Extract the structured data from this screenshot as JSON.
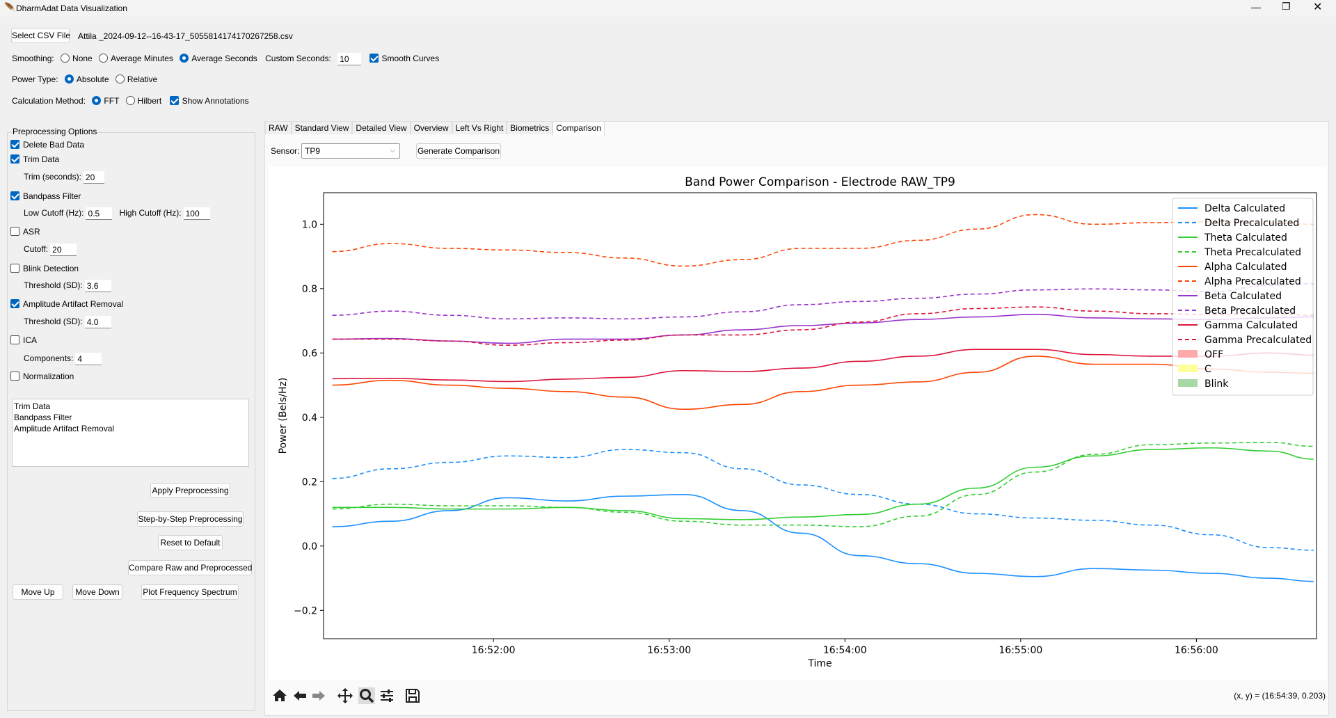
{
  "window": {
    "title": "DharmAdat Data Visualization",
    "icon": "feather-icon"
  },
  "file": {
    "button": "Select CSV File",
    "name": "Attila _2024-09-12--16-43-17_5055814174170267258.csv"
  },
  "smoothing": {
    "label": "Smoothing:",
    "options": [
      "None",
      "Average Minutes",
      "Average Seconds"
    ],
    "selected": "Average Seconds",
    "custom_label": "Custom Seconds:",
    "custom_value": "10",
    "smooth_curves": "Smooth Curves",
    "smooth_checked": true
  },
  "power": {
    "label": "Power Type:",
    "options": [
      "Absolute",
      "Relative"
    ],
    "selected": "Absolute"
  },
  "calc": {
    "label": "Calculation Method:",
    "options": [
      "FFT",
      "Hilbert"
    ],
    "selected": "FFT",
    "annotations": "Show Annotations",
    "annotations_checked": true
  },
  "prep": {
    "title": "Preprocessing Options",
    "delete_bad": "Delete Bad Data",
    "trim": "Trim Data",
    "trim_label": "Trim (seconds):",
    "trim_value": "20",
    "bandpass": "Bandpass Filter",
    "low_label": "Low Cutoff (Hz):",
    "low_value": "0.5",
    "high_label": "High Cutoff (Hz):",
    "high_value": "100",
    "asr": "ASR",
    "asr_label": "Cutoff:",
    "asr_value": "20",
    "blink": "Blink Detection",
    "blink_label": "Threshold (SD):",
    "blink_value": "3.6",
    "amp": "Amplitude Artifact Removal",
    "amp_label": "Threshold (SD):",
    "amp_value": "4.0",
    "ica": "ICA",
    "ica_label": "Components:",
    "ica_value": "4",
    "norm": "Normalization",
    "checked": {
      "delete_bad": true,
      "trim": true,
      "bandpass": true,
      "asr": false,
      "blink": false,
      "amp": true,
      "ica": false,
      "norm": false
    },
    "steps": [
      "Trim Data",
      "Bandpass Filter",
      "Amplitude Artifact Removal"
    ],
    "buttons": {
      "apply": "Apply Preprocessing",
      "step": "Step-by-Step Preprocessing",
      "reset": "Reset to Default",
      "compare": "Compare Raw and Preprocessed",
      "up": "Move Up",
      "down": "Move Down",
      "freq": "Plot Frequency Spectrum"
    }
  },
  "tabs": [
    "RAW",
    "Standard View",
    "Detailed View",
    "Overview",
    "Left Vs Right",
    "Biometrics",
    "Comparison"
  ],
  "active_tab": "Comparison",
  "sensor": {
    "label": "Sensor:",
    "value": "TP9",
    "generate": "Generate Comparison"
  },
  "status": {
    "coords": "(x, y) = (16:54:39, 0.203)"
  },
  "toolbar": [
    "home-icon",
    "back-icon",
    "forward-icon",
    "pan-icon",
    "zoom-icon",
    "configure-icon",
    "save-icon"
  ],
  "chart_data": {
    "type": "line",
    "title": "Band Power Comparison - Electrode RAW_TP9",
    "xlabel": "Time",
    "ylabel": "Power (Bels/Hz)",
    "xlim": [
      "16:51:02",
      "16:56:41"
    ],
    "ylim": [
      -0.288,
      1.098
    ],
    "xticks": [
      "16:52:00",
      "16:53:00",
      "16:54:00",
      "16:55:00",
      "16:56:00"
    ],
    "yticks": [
      -0.2,
      0.0,
      0.2,
      0.4,
      0.6,
      0.8,
      1.0
    ],
    "grid": false,
    "legend": "top-right",
    "x": [
      "16:51:05",
      "16:51:25",
      "16:51:45",
      "16:52:05",
      "16:52:25",
      "16:52:45",
      "16:53:05",
      "16:53:25",
      "16:53:45",
      "16:54:05",
      "16:54:25",
      "16:54:45",
      "16:55:05",
      "16:55:25",
      "16:55:45",
      "16:56:05",
      "16:56:25",
      "16:56:40"
    ],
    "series": [
      {
        "name": "Delta Calculated",
        "color": "#1e90ff",
        "dash": false,
        "values": [
          0.06,
          0.077,
          0.11,
          0.15,
          0.14,
          0.155,
          0.16,
          0.11,
          0.04,
          -0.03,
          -0.055,
          -0.085,
          -0.095,
          -0.07,
          -0.075,
          -0.085,
          -0.1,
          -0.11
        ]
      },
      {
        "name": "Delta Precalculated",
        "color": "#1e90ff",
        "dash": true,
        "values": [
          0.21,
          0.24,
          0.26,
          0.28,
          0.275,
          0.3,
          0.29,
          0.24,
          0.19,
          0.16,
          0.13,
          0.1,
          0.087,
          0.08,
          0.065,
          0.035,
          -0.005,
          -0.013
        ]
      },
      {
        "name": "Theta Calculated",
        "color": "#32cd32",
        "dash": false,
        "values": [
          0.12,
          0.12,
          0.115,
          0.115,
          0.12,
          0.11,
          0.085,
          0.082,
          0.09,
          0.098,
          0.13,
          0.18,
          0.245,
          0.28,
          0.3,
          0.305,
          0.295,
          0.27
        ]
      },
      {
        "name": "Theta Precalculated",
        "color": "#32cd32",
        "dash": true,
        "values": [
          0.115,
          0.13,
          0.125,
          0.125,
          0.12,
          0.105,
          0.077,
          0.065,
          0.065,
          0.06,
          0.093,
          0.16,
          0.23,
          0.285,
          0.315,
          0.32,
          0.322,
          0.31
        ]
      },
      {
        "name": "Alpha Calculated",
        "color": "#ff4500",
        "dash": false,
        "values": [
          0.5,
          0.515,
          0.5,
          0.49,
          0.48,
          0.463,
          0.425,
          0.44,
          0.48,
          0.5,
          0.51,
          0.54,
          0.59,
          0.565,
          0.565,
          0.55,
          0.54,
          0.537
        ]
      },
      {
        "name": "Alpha Precalculated",
        "color": "#ff4500",
        "dash": true,
        "values": [
          0.915,
          0.94,
          0.925,
          0.92,
          0.912,
          0.895,
          0.87,
          0.89,
          0.925,
          0.925,
          0.95,
          0.985,
          1.03,
          1.0,
          1.005,
          1.008,
          1.003,
          1.0
        ]
      },
      {
        "name": "Beta Calculated",
        "color": "#9932cc",
        "dash": false,
        "values": [
          0.643,
          0.645,
          0.637,
          0.63,
          0.643,
          0.643,
          0.656,
          0.672,
          0.685,
          0.693,
          0.704,
          0.712,
          0.72,
          0.709,
          0.706,
          0.704,
          0.709,
          0.712
        ]
      },
      {
        "name": "Beta Precalculated",
        "color": "#9932cc",
        "dash": true,
        "values": [
          0.717,
          0.73,
          0.717,
          0.706,
          0.709,
          0.706,
          0.712,
          0.728,
          0.75,
          0.76,
          0.77,
          0.783,
          0.796,
          0.799,
          0.796,
          0.79,
          0.81,
          0.815
        ]
      },
      {
        "name": "Gamma Calculated",
        "color": "#dc143c",
        "dash": false,
        "values": [
          0.52,
          0.521,
          0.516,
          0.511,
          0.519,
          0.524,
          0.545,
          0.542,
          0.553,
          0.574,
          0.59,
          0.611,
          0.611,
          0.595,
          0.59,
          0.59,
          0.6,
          0.593
        ]
      },
      {
        "name": "Gamma Precalculated",
        "color": "#dc143c",
        "dash": true,
        "values": [
          0.643,
          0.643,
          0.637,
          0.624,
          0.632,
          0.64,
          0.656,
          0.656,
          0.672,
          0.696,
          0.722,
          0.738,
          0.743,
          0.73,
          0.722,
          0.72,
          0.722,
          0.717
        ]
      }
    ],
    "annotation_legend": [
      {
        "name": "OFF",
        "color": "#ffaaaa"
      },
      {
        "name": "C",
        "color": "#ffff99"
      },
      {
        "name": "Blink",
        "color": "#a8d8a8"
      }
    ]
  }
}
